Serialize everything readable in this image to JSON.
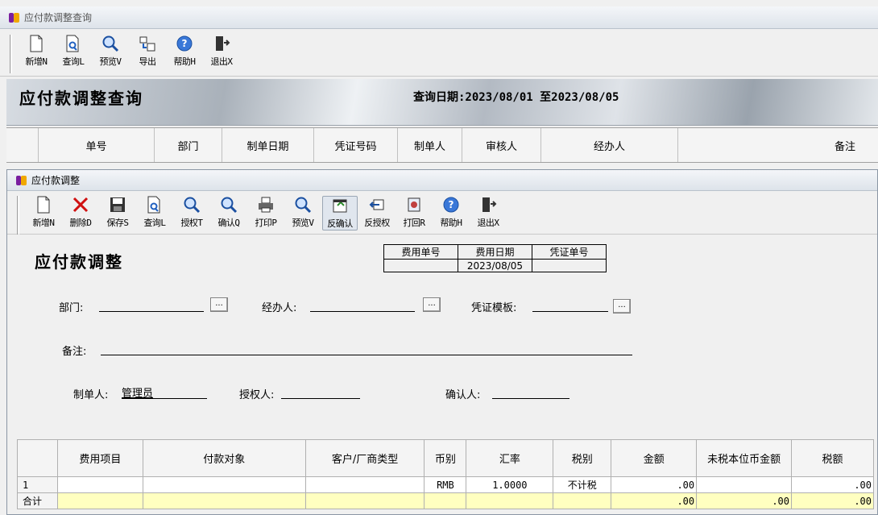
{
  "outer": {
    "title": "应付款调整查询",
    "toolbar": [
      {
        "name": "new",
        "label": "新增N"
      },
      {
        "name": "query",
        "label": "查询L"
      },
      {
        "name": "preview",
        "label": "预览V"
      },
      {
        "name": "export",
        "label": "导出"
      },
      {
        "name": "help",
        "label": "帮助H"
      },
      {
        "name": "exit",
        "label": "退出X"
      }
    ],
    "banner_title": "应付款调整查询",
    "query_date": "查询日期:2023/08/01 至2023/08/05",
    "grid_headers": [
      "单号",
      "部门",
      "制单日期",
      "凭证号码",
      "制单人",
      "审核人",
      "经办人",
      "备注"
    ]
  },
  "inner": {
    "title": "应付款调整",
    "toolbar": [
      {
        "name": "new",
        "label": "新增N"
      },
      {
        "name": "delete",
        "label": "删除D"
      },
      {
        "name": "save",
        "label": "保存S"
      },
      {
        "name": "query",
        "label": "查询L"
      },
      {
        "name": "authorize",
        "label": "授权T"
      },
      {
        "name": "confirm",
        "label": "确认Q"
      },
      {
        "name": "print",
        "label": "打印P"
      },
      {
        "name": "preview",
        "label": "预览V"
      },
      {
        "name": "unconfirm",
        "label": "反确认"
      },
      {
        "name": "unauthorize",
        "label": "反授权"
      },
      {
        "name": "recall",
        "label": "打回R"
      },
      {
        "name": "help",
        "label": "帮助H"
      },
      {
        "name": "exit",
        "label": "退出X"
      }
    ],
    "form_title": "应付款调整",
    "info": {
      "headers": [
        "费用单号",
        "费用日期",
        "凭证单号"
      ],
      "values": [
        "",
        "2023/08/05",
        ""
      ]
    },
    "fields": {
      "department_label": "部门:",
      "handler_label": "经办人:",
      "template_label": "凭证模板:",
      "remark_label": "备注:",
      "maker_label": "制单人:",
      "maker_value": "管理员",
      "authorizer_label": "授权人:",
      "confirmer_label": "确认人:",
      "pick": "..."
    },
    "detail": {
      "headers": [
        "",
        "费用项目",
        "付款对象",
        "客户/厂商类型",
        "币别",
        "汇率",
        "税别",
        "金额",
        "未税本位币金额",
        "税额"
      ],
      "rows": [
        [
          "1",
          "",
          "",
          "",
          "RMB",
          "1.0000",
          "不计税",
          ".00",
          "",
          ".00"
        ]
      ],
      "total": [
        "合计",
        "",
        "",
        "",
        "",
        "",
        "",
        ".00",
        ".00",
        ".00"
      ]
    }
  }
}
